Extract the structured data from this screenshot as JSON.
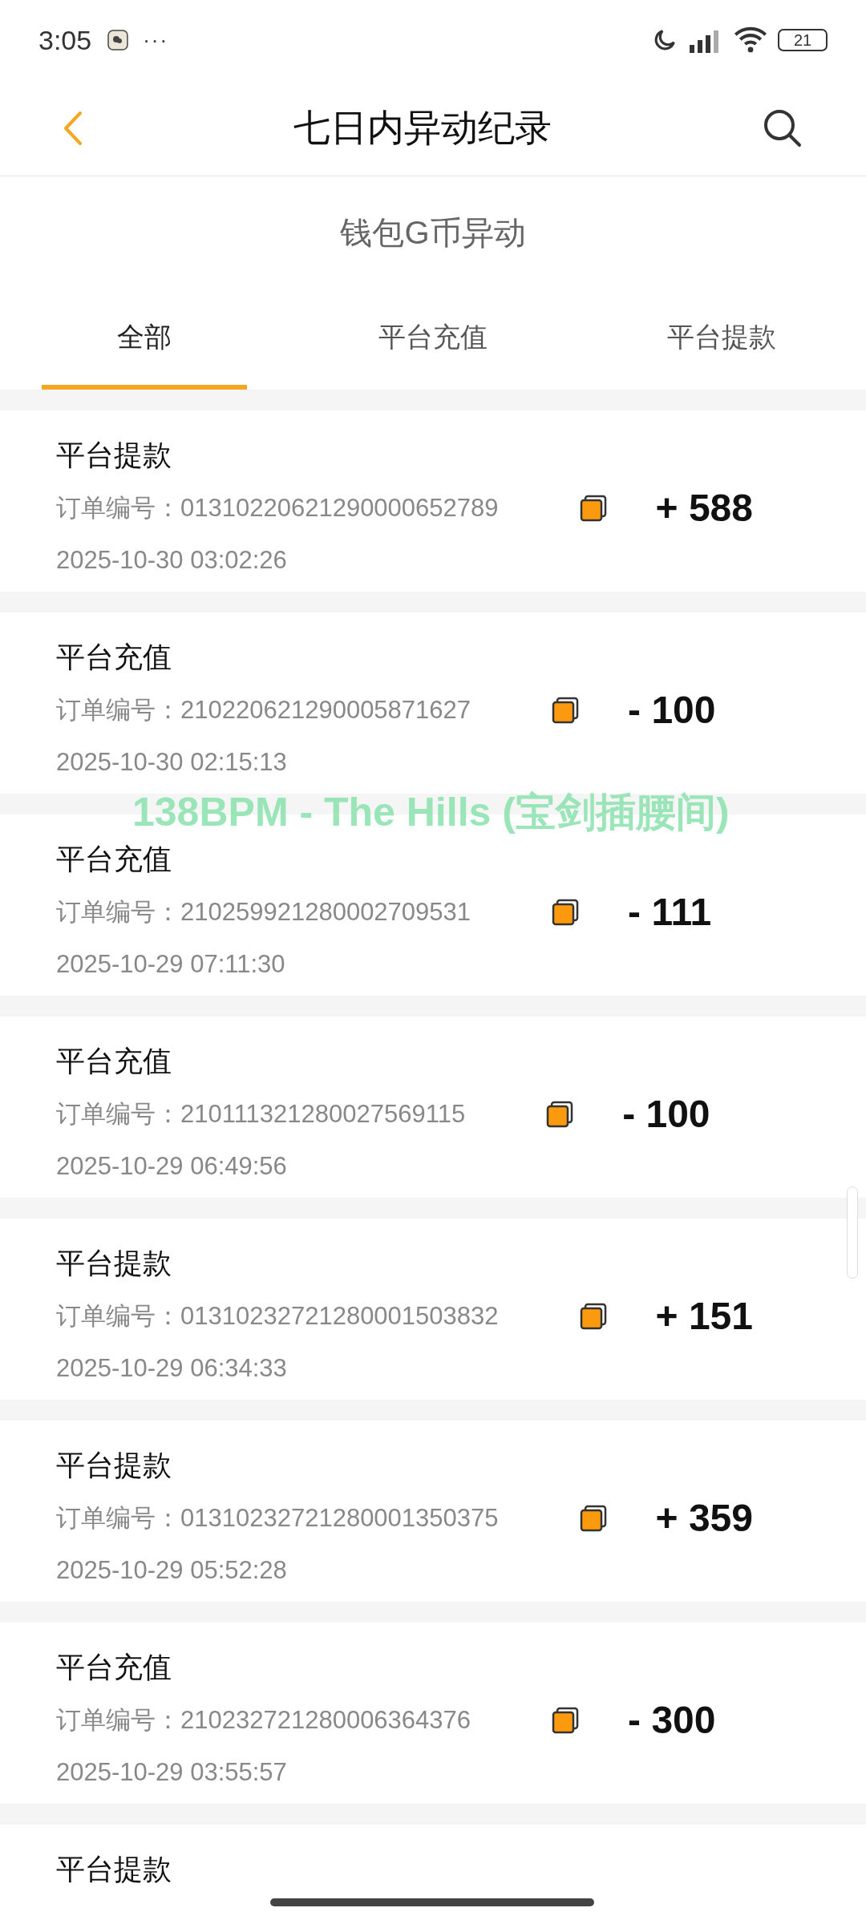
{
  "status_bar": {
    "time": "3:05",
    "more": "···",
    "battery": "21"
  },
  "header": {
    "title": "七日内异动纪录"
  },
  "section_title": "钱包G币异动",
  "tabs": [
    {
      "label": "全部",
      "selected": true
    },
    {
      "label": "平台充值",
      "selected": false
    },
    {
      "label": "平台提款",
      "selected": false
    }
  ],
  "records": [
    {
      "type": "平台提款",
      "order_label": "订单编号：",
      "order_no": "01310220621290000652789",
      "time": "2025-10-30 03:02:26",
      "amount": "+ 588"
    },
    {
      "type": "平台充值",
      "order_label": "订单编号：",
      "order_no": "210220621290005871627",
      "time": "2025-10-30 02:15:13",
      "amount": "- 100"
    },
    {
      "type": "平台充值",
      "order_label": "订单编号：",
      "order_no": "210259921280002709531",
      "time": "2025-10-29 07:11:30",
      "amount": "- 111"
    },
    {
      "type": "平台充值",
      "order_label": "订单编号：",
      "order_no": "210111321280027569115",
      "time": "2025-10-29 06:49:56",
      "amount": "- 100"
    },
    {
      "type": "平台提款",
      "order_label": "订单编号：",
      "order_no": "01310232721280001503832",
      "time": "2025-10-29 06:34:33",
      "amount": "+ 151"
    },
    {
      "type": "平台提款",
      "order_label": "订单编号：",
      "order_no": "01310232721280001350375",
      "time": "2025-10-29 05:52:28",
      "amount": "+ 359"
    },
    {
      "type": "平台充值",
      "order_label": "订单编号：",
      "order_no": "210232721280006364376",
      "time": "2025-10-29 03:55:57",
      "amount": "- 300"
    },
    {
      "type": "平台提款"
    }
  ],
  "floating_lyrics": "138BPM - The Hills (宝剑插腰间)"
}
